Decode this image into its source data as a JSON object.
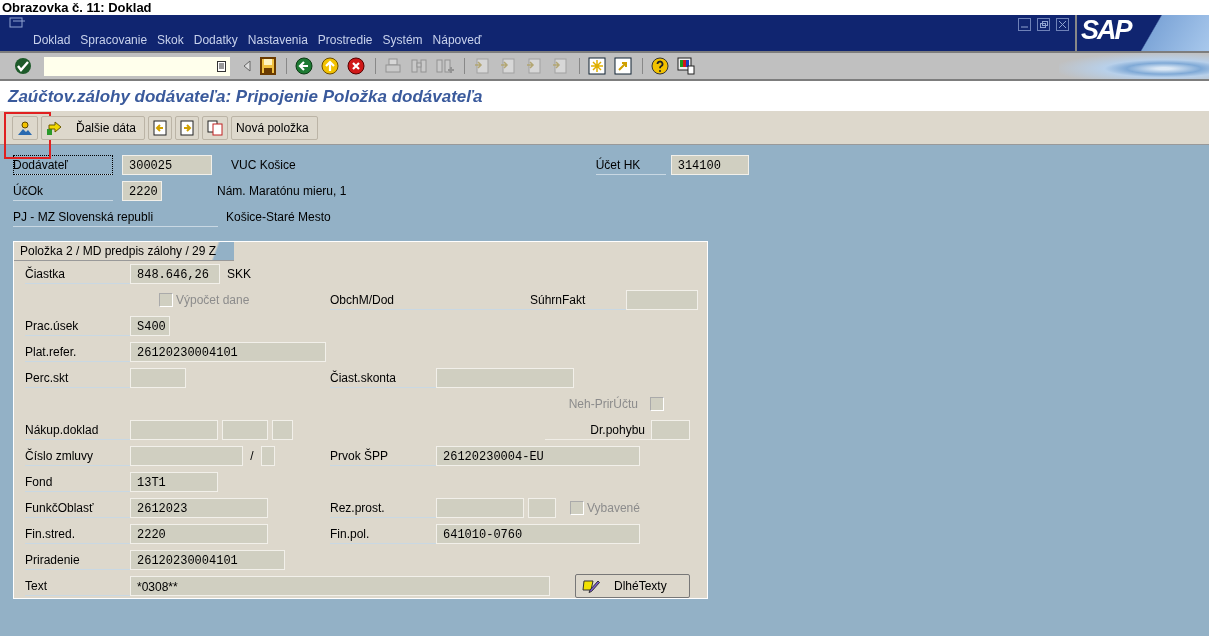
{
  "caption": "Obrazovka č. 11: Doklad",
  "menu": [
    {
      "label": "Doklad"
    },
    {
      "label": "Spracovanie"
    },
    {
      "label": "Skok"
    },
    {
      "label": "Dodatky"
    },
    {
      "label": "Nastavenia"
    },
    {
      "label": "Prostredie"
    },
    {
      "label": "Systém"
    },
    {
      "label": "Nápoveď"
    }
  ],
  "logo": "SAP",
  "title": "Zaúčtov.zálohy dodávateľa: Pripojenie Položka dodávateľa",
  "app_toolbar": [
    {
      "kind": "person",
      "highlighted": true
    },
    {
      "kind": "arrow",
      "label": "Ďalšie dáta",
      "highlighted": false
    },
    {
      "kind": "prev",
      "highlighted": false
    },
    {
      "kind": "next",
      "highlighted": false
    },
    {
      "kind": "copy",
      "highlighted": false
    },
    {
      "kind": "text",
      "label": "Nová položka",
      "highlighted": false
    }
  ],
  "header": {
    "vendor_label": "Dodávateľ",
    "vendor_focused": true,
    "vendor": "300025",
    "vendor_name": "VUC Košice",
    "gl_label": "Účet HK",
    "gl": "314100",
    "cc_label": "ÚčOk",
    "cc": "2220",
    "street": "Nám. Maratónu mieru, 1",
    "org": "PJ - MZ Slovenská republi",
    "city": "Košice-Staré Mesto"
  },
  "item": {
    "tab": "Položka 2 / MD predpis zálohy / 29 Z",
    "amount_label": "Čiastka",
    "amount": "848.646,26",
    "currency": "SKK",
    "tax_check": {
      "label": "Výpočet dane",
      "checked": false,
      "disabled": true
    },
    "obch_label": "ObchM/Dod",
    "suhrn_label": "SúhrnFakt",
    "prac_label": "Prac.úsek",
    "prac": "S400",
    "plat_label": "Plat.refer.",
    "plat": "26120230004101",
    "perc_label": "Perc.skt",
    "skonta_label": "Čiast.skonta",
    "neh_check": {
      "label": "Neh-PrirÚčtu",
      "checked": false,
      "disabled": true
    },
    "nakup_label": "Nákup.doklad",
    "pohyb_label": "Dr.pohybu",
    "zmluva_label": "Číslo zmluvy",
    "slash": "/",
    "spp_label": "Prvok ŠPP",
    "spp": "26120230004-EU",
    "fond_label": "Fond",
    "fond": "13T1",
    "funk_label": "FunkčOblasť",
    "funk": "2612023",
    "rez_label": "Rez.prost.",
    "vyb_check": {
      "label": "Vybavené",
      "checked": false,
      "disabled": true
    },
    "fin_stred_label": "Fin.stred.",
    "fin_stred": "2220",
    "fin_pol_label": "Fin.pol.",
    "fin_pol": "641010-0760",
    "prir_label": "Priradenie",
    "prir": "26120230004101",
    "text_label": "Text",
    "text": "*0308**",
    "long_texts": "DlhéTexty"
  }
}
